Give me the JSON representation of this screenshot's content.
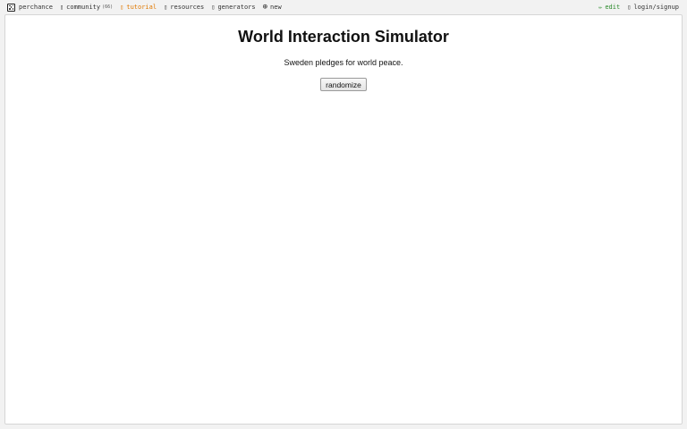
{
  "nav": {
    "brand_label": "perchance",
    "community_label": "community",
    "community_count": "(66)",
    "tutorial_label": "tutorial",
    "resources_label": "resources",
    "generators_label": "generators",
    "new_label": "new",
    "edit_label": "edit",
    "login_label": "login/signup",
    "icons": {
      "brand": "die-icon",
      "community": "chat-icon",
      "tutorial": "book-icon",
      "resources": "box-icon",
      "generators": "grid-icon",
      "new": "plus-circle-icon",
      "edit": "pencil-icon",
      "login": "user-icon"
    },
    "colors": {
      "tutorial": "#e07800",
      "edit": "#2a8a2a"
    }
  },
  "main": {
    "title": "World Interaction Simulator",
    "output_text": "Sweden pledges for world peace.",
    "randomize_label": "randomize"
  }
}
